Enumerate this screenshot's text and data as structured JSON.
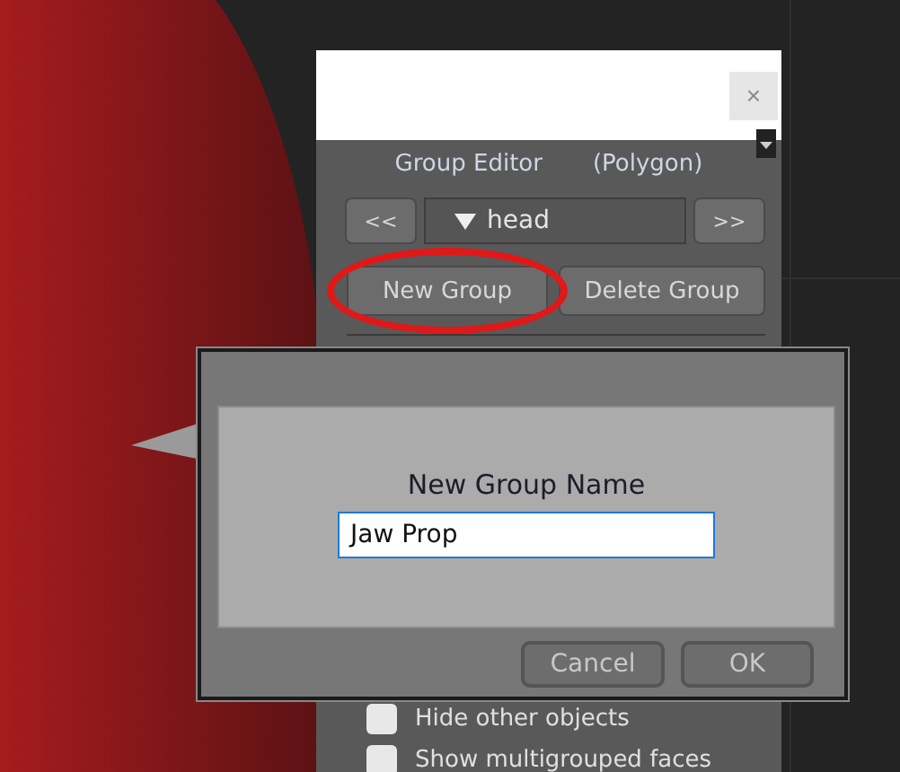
{
  "panel": {
    "close_button": "×",
    "title": "Group Editor",
    "mode": "(Polygon)",
    "prev_button": "<<",
    "group_select": "head",
    "next_button": ">>",
    "buttons": [
      {
        "label": "New Group",
        "highlighted": true
      },
      {
        "label": "Delete Group",
        "highlighted": false
      }
    ],
    "options": [
      {
        "label": "Hide other objects",
        "checked": false
      },
      {
        "label": "Show multigrouped faces",
        "checked": false
      }
    ]
  },
  "dialog": {
    "label": "New Group Name",
    "field_value": "Jaw Prop",
    "buttons": [
      "Cancel",
      "OK"
    ]
  }
}
